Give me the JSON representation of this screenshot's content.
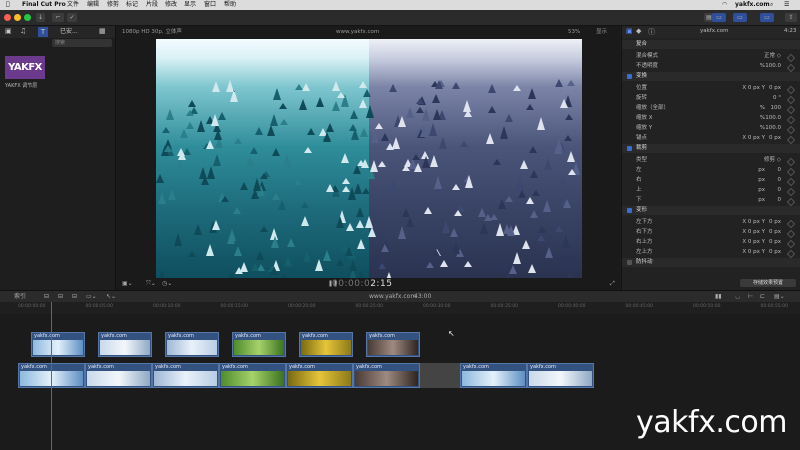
{
  "menubar": {
    "app_name": "Final Cut Pro",
    "items": [
      "文件",
      "编辑",
      "修剪",
      "标记",
      "片段",
      "修改",
      "显示",
      "窗口",
      "帮助"
    ],
    "right_site": "yakfx.com"
  },
  "toolbar": {
    "button_labels": [
      "",
      "",
      "",
      "",
      "",
      ""
    ]
  },
  "browser": {
    "library_label": "已安...",
    "search_placeholder": "搜索",
    "clip_name": "YAKFX",
    "clip_label": "YAKFX 调节层"
  },
  "viewer": {
    "format": "1080p HD 30p, 立体声",
    "title": "www.yakfx.com",
    "zoom": "53%",
    "display_label": "显示",
    "timecode_dim": "00:00:0",
    "timecode_bright": "2:15"
  },
  "inspector": {
    "site": "yakfx.com",
    "time": "4:23",
    "rows": [
      {
        "label": "复合",
        "type": "section",
        "value": "",
        "unit": "",
        "check": ""
      },
      {
        "label": "混合模式",
        "type": "row",
        "value": "正常 ◇",
        "unit": "",
        "check": ""
      },
      {
        "label": "不透明度",
        "type": "row",
        "value": "100.0",
        "unit": "%",
        "check": ""
      },
      {
        "label": "变换",
        "type": "section",
        "value": "",
        "unit": "",
        "check": "on"
      },
      {
        "label": "位置",
        "type": "row",
        "value": "0  px",
        "unit": "X   0  px  Y",
        "check": ""
      },
      {
        "label": "旋转",
        "type": "row",
        "value": "0 °",
        "unit": "",
        "check": ""
      },
      {
        "label": "缩放（全部）",
        "type": "row",
        "value": "100",
        "unit": "%",
        "check": ""
      },
      {
        "label": "缩放 X",
        "type": "row",
        "value": "100.0",
        "unit": "%",
        "check": ""
      },
      {
        "label": "缩放 Y",
        "type": "row",
        "value": "100.0",
        "unit": "%",
        "check": ""
      },
      {
        "label": "锚点",
        "type": "row",
        "value": "0  px",
        "unit": "X   0  px  Y",
        "check": ""
      },
      {
        "label": "裁剪",
        "type": "section",
        "value": "",
        "unit": "",
        "check": "on"
      },
      {
        "label": "类型",
        "type": "row",
        "value": "修剪 ◇",
        "unit": "",
        "check": ""
      },
      {
        "label": "左",
        "type": "row",
        "value": "0",
        "unit": "px",
        "check": ""
      },
      {
        "label": "右",
        "type": "row",
        "value": "0",
        "unit": "px",
        "check": ""
      },
      {
        "label": "上",
        "type": "row",
        "value": "0",
        "unit": "px",
        "check": ""
      },
      {
        "label": "下",
        "type": "row",
        "value": "0",
        "unit": "px",
        "check": ""
      },
      {
        "label": "变形",
        "type": "section",
        "value": "",
        "unit": "",
        "check": "on"
      },
      {
        "label": "左下方",
        "type": "row",
        "value": "0  px",
        "unit": "X   0  px  Y",
        "check": ""
      },
      {
        "label": "右下方",
        "type": "row",
        "value": "0  px",
        "unit": "X   0  px  Y",
        "check": ""
      },
      {
        "label": "右上方",
        "type": "row",
        "value": "0  px",
        "unit": "X   0  px  Y",
        "check": ""
      },
      {
        "label": "左上方",
        "type": "row",
        "value": "0  px",
        "unit": "X   0  px  Y",
        "check": ""
      },
      {
        "label": "防抖动",
        "type": "section",
        "value": "",
        "unit": "",
        "check": "off"
      }
    ],
    "save_preset": "存储效果预置"
  },
  "timeline": {
    "index_label": "索引",
    "project_title": "www.yakfx.com",
    "duration": "43:00",
    "ruler_ticks": [
      "00:00:00:00",
      "00:00:05:00",
      "00:00:10:00",
      "00:00:15:00",
      "00:00:20:00",
      "00:00:25:00",
      "00:00:30:00",
      "00:00:35:00",
      "00:00:40:00",
      "00:00:45:00",
      "00:00:50:00",
      "00:00:55:00"
    ],
    "clip_label": "yakfx.com"
  },
  "watermark": "yakfx.com",
  "colors": {
    "accent": "#3d6bd6",
    "clip": "#34527f",
    "playhead": "#dd3333",
    "yakfx_purple": "#6b3a8d"
  }
}
